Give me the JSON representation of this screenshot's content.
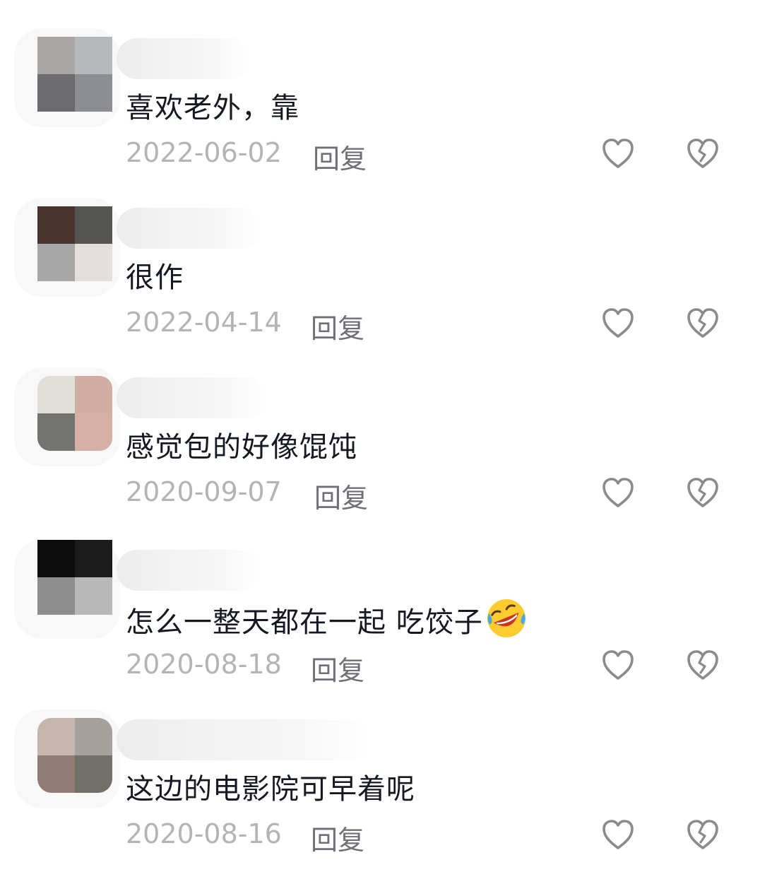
{
  "comments": [
    {
      "text": "喜欢老外，靠",
      "date": "2022-06-02",
      "reply_label": "回复",
      "emoji": ""
    },
    {
      "text": "很作",
      "date": "2022-04-14",
      "reply_label": "回复",
      "emoji": ""
    },
    {
      "text": "感觉包的好像馄饨",
      "date": "2020-09-07",
      "reply_label": "回复",
      "emoji": ""
    },
    {
      "text": "怎么一整天都在一起 吃饺子",
      "date": "2020-08-18",
      "reply_label": "回复",
      "emoji": "rolling-on-floor-laughing-emoji"
    },
    {
      "text": "这边的电影院可早着呢",
      "date": "2020-08-16",
      "reply_label": "回复",
      "emoji": ""
    }
  ],
  "icons": {
    "like": "heart-outline-icon",
    "dislike": "broken-heart-icon"
  },
  "colors": {
    "text": "#161823",
    "date": "#b4b4b8",
    "reply": "#6f6f76",
    "icon": "#8a8a8f"
  }
}
